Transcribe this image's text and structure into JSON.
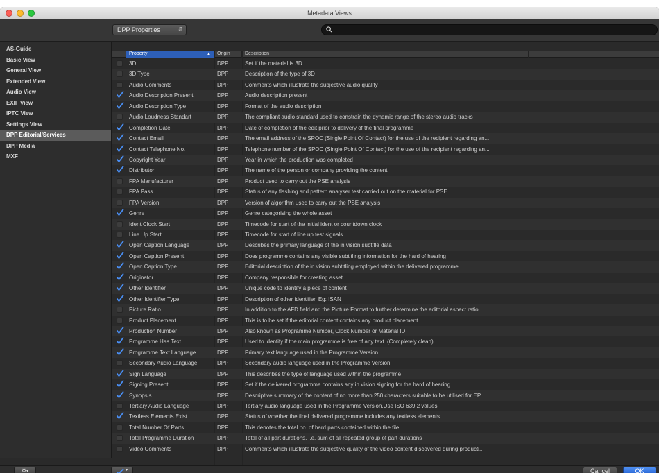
{
  "window": {
    "title": "Metadata Views"
  },
  "toolbar": {
    "view_popup": "DPP Properties",
    "search_value": ""
  },
  "sidebar": {
    "items": [
      {
        "label": "AS-Guide",
        "selected": false
      },
      {
        "label": "Basic View",
        "selected": false
      },
      {
        "label": "General View",
        "selected": false
      },
      {
        "label": "Extended View",
        "selected": false
      },
      {
        "label": "Audio View",
        "selected": false
      },
      {
        "label": "EXIF View",
        "selected": false
      },
      {
        "label": "IPTC View",
        "selected": false
      },
      {
        "label": "Settings View",
        "selected": false
      },
      {
        "label": "DPP Editorial/Services",
        "selected": true
      },
      {
        "label": "DPP Media",
        "selected": false
      },
      {
        "label": "MXF",
        "selected": false
      }
    ]
  },
  "table": {
    "columns": {
      "property": "Property",
      "origin": "Origin",
      "description": "Description"
    },
    "rows": [
      {
        "checked": false,
        "property": "3D",
        "origin": "DPP",
        "description": "Set if the material is 3D"
      },
      {
        "checked": false,
        "property": "3D Type",
        "origin": "DPP",
        "description": "Description of the type of 3D"
      },
      {
        "checked": false,
        "property": "Audio Comments",
        "origin": "DPP",
        "description": "Comments which illustrate the subjective audio quality"
      },
      {
        "checked": true,
        "property": "Audio Description Present",
        "origin": "DPP",
        "description": "Audio description present"
      },
      {
        "checked": true,
        "property": "Audio Description Type",
        "origin": "DPP",
        "description": "Format of the audio description"
      },
      {
        "checked": false,
        "property": "Audio Loudness Standart",
        "origin": "DPP",
        "description": "The compliant audio standard used to constrain the dynamic range of the stereo audio tracks"
      },
      {
        "checked": true,
        "property": "Completion Date",
        "origin": "DPP",
        "description": "Date of completion of the edit prior to delivery of the final programme"
      },
      {
        "checked": true,
        "property": "Contact Email",
        "origin": "DPP",
        "description": "The email address of the SPOC (Single Point Of Contact) for the use of the recipient regarding an..."
      },
      {
        "checked": true,
        "property": "Contact Telephone No.",
        "origin": "DPP",
        "description": "Telephone number of the SPOC (Single Point Of Contact) for the use of the recipient regarding an..."
      },
      {
        "checked": true,
        "property": "Copyright Year",
        "origin": "DPP",
        "description": "Year in which the production was completed"
      },
      {
        "checked": true,
        "property": "Distributor",
        "origin": "DPP",
        "description": "The name of the person or company providing the content"
      },
      {
        "checked": false,
        "property": "FPA Manufacturer",
        "origin": "DPP",
        "description": "Product used to carry out the PSE analysis"
      },
      {
        "checked": false,
        "property": "FPA Pass",
        "origin": "DPP",
        "description": "Status of any flashing and pattern analyser test carried out on the material for PSE"
      },
      {
        "checked": false,
        "property": "FPA Version",
        "origin": "DPP",
        "description": "Version of algorithm used to carry out the PSE analysis"
      },
      {
        "checked": true,
        "property": "Genre",
        "origin": "DPP",
        "description": "Genre categorising the whole asset"
      },
      {
        "checked": false,
        "property": "Ident Clock Start",
        "origin": "DPP",
        "description": "Timecode for start of the initial ident or countdown clock"
      },
      {
        "checked": false,
        "property": "Line Up Start",
        "origin": "DPP",
        "description": "Timecode for start of line up test signals"
      },
      {
        "checked": true,
        "property": "Open Caption Language",
        "origin": "DPP",
        "description": "Describes the primary language of the in vision subtitle data"
      },
      {
        "checked": true,
        "property": "Open Caption Present",
        "origin": "DPP",
        "description": "Does programme contains any visible subtitling information for the hard of hearing"
      },
      {
        "checked": true,
        "property": "Open Caption Type",
        "origin": "DPP",
        "description": "Editorial description of the in vision subtitling employed within the delivered programme"
      },
      {
        "checked": true,
        "property": "Originator",
        "origin": "DPP",
        "description": "Company responsible for creating asset"
      },
      {
        "checked": true,
        "property": "Other Identifier",
        "origin": "DPP",
        "description": "Unique code to identify a piece of content"
      },
      {
        "checked": true,
        "property": "Other Identifier Type",
        "origin": "DPP",
        "description": "Description of other identifier, Eg: ISAN"
      },
      {
        "checked": false,
        "property": "Picture Ratio",
        "origin": "DPP",
        "description": "In addition to the AFD field and the Picture Format to further determine the editorial aspect ratio..."
      },
      {
        "checked": false,
        "property": "Product Placement",
        "origin": "DPP",
        "description": "This is to be set if the editorial content contains any product placement"
      },
      {
        "checked": true,
        "property": "Production Number",
        "origin": "DPP",
        "description": "Also known as Programme Number, Clock Number or Material ID"
      },
      {
        "checked": true,
        "property": "Programme Has Text",
        "origin": "DPP",
        "description": "Used to identify if the main programme is free of any text. (Completely clean)"
      },
      {
        "checked": true,
        "property": "Programme Text Language",
        "origin": "DPP",
        "description": "Primary text language used in the Programme Version"
      },
      {
        "checked": false,
        "property": "Secondary Audio Language",
        "origin": "DPP",
        "description": "Secondary audio language used in the Programme Version"
      },
      {
        "checked": true,
        "property": "Sign Language",
        "origin": "DPP",
        "description": "This describes the type of language used within the programme"
      },
      {
        "checked": true,
        "property": "Signing Present",
        "origin": "DPP",
        "description": "Set if the delivered programme contains any in vision signing for the hard of hearing"
      },
      {
        "checked": true,
        "property": "Synopsis",
        "origin": "DPP",
        "description": "Descriptive summary of the content of no more than 250 characters suitable to be utilised for EP..."
      },
      {
        "checked": false,
        "property": "Tertiary Audio Language",
        "origin": "DPP",
        "description": "Tertiary audio language used in the Programme Version.Use ISO 639.2 values"
      },
      {
        "checked": true,
        "property": "Textless Elements Exist",
        "origin": "DPP",
        "description": "Status of whether the final delivered programme includes any textless elements"
      },
      {
        "checked": false,
        "property": "Total Number Of Parts",
        "origin": "DPP",
        "description": "This denotes the total no. of hard parts contained within the file"
      },
      {
        "checked": false,
        "property": "Total Programme Duration",
        "origin": "DPP",
        "description": "Total of all part durations, i.e. sum of all repeated group of part durations"
      },
      {
        "checked": false,
        "property": "Video Comments",
        "origin": "DPP",
        "description": "Comments which illustrate the subjective quality of the video content discovered during producti..."
      }
    ]
  },
  "footer": {
    "cancel_label": "Cancel",
    "ok_label": "OK"
  },
  "colors": {
    "accent": "#2d5fb8",
    "checkmark": "#4a8ff5",
    "ok_button": "#2f6fe0"
  }
}
